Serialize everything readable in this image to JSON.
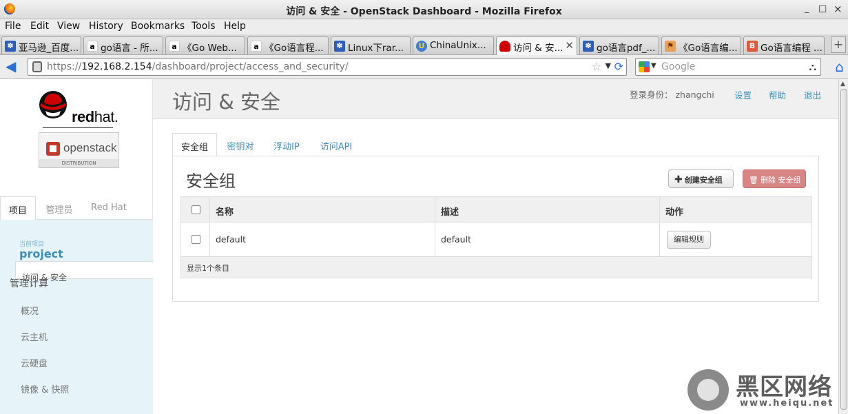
{
  "window": {
    "title": "访问 & 安全 - OpenStack Dashboard - Mozilla Firefox",
    "controls": [
      "_",
      "□",
      "×"
    ]
  },
  "menu": [
    "File",
    "Edit",
    "View",
    "History",
    "Bookmarks",
    "Tools",
    "Help"
  ],
  "tabs": [
    {
      "label": "亚马逊_百度...",
      "icon": "paw-icon"
    },
    {
      "label": "go语言 - 所...",
      "icon": "amazon-icon"
    },
    {
      "label": "《Go Web...",
      "icon": "amazon-icon"
    },
    {
      "label": "《Go语言程...",
      "icon": "amazon-icon"
    },
    {
      "label": "Linux下rar...",
      "icon": "paw-icon"
    },
    {
      "label": "ChinaUnix...",
      "icon": "chinaunix-icon"
    },
    {
      "label": "访问 & 安...",
      "icon": "redhat-icon",
      "active": true
    },
    {
      "label": "go语言pdf_...",
      "icon": "paw-icon"
    },
    {
      "label": "《Go语言编...",
      "icon": "book-icon"
    },
    {
      "label": "Go语言编程 ...",
      "icon": "b-icon"
    }
  ],
  "url": {
    "prefix": "https://",
    "host": "192.168.2.154",
    "path": "/dashboard/project/access_and_security/"
  },
  "search": {
    "placeholder": "Google"
  },
  "sidebar": {
    "logo_text": "redhat",
    "openstack_text": "openstack",
    "distribution": "DISTRIBUTION",
    "tabs": [
      "项目",
      "管理员",
      "Red Hat"
    ],
    "current_project_label": "当前项目",
    "current_project": "project",
    "section_title": "管理计算",
    "items": [
      "概况",
      "云主机",
      "云硬盘",
      "镜像 & 快照"
    ],
    "active_item": "访问 & 安全"
  },
  "header": {
    "title": "访问 & 安全",
    "login": "登录身份： zhangchi",
    "settings": "设置",
    "help": "帮助",
    "logout": "退出"
  },
  "page_tabs": [
    "安全组",
    "密钥对",
    "浮动IP",
    "访问API"
  ],
  "panel": {
    "title": "安全组",
    "create_button": "创建安全组",
    "delete_button": "删除 安全组",
    "columns": [
      "名称",
      "描述",
      "动作"
    ],
    "rows": [
      {
        "name": "default",
        "description": "default",
        "action": "编辑规则"
      }
    ],
    "footer": "显示1个条目"
  },
  "watermark": {
    "text": "黑区网络",
    "url": "www.heiqu.net"
  }
}
